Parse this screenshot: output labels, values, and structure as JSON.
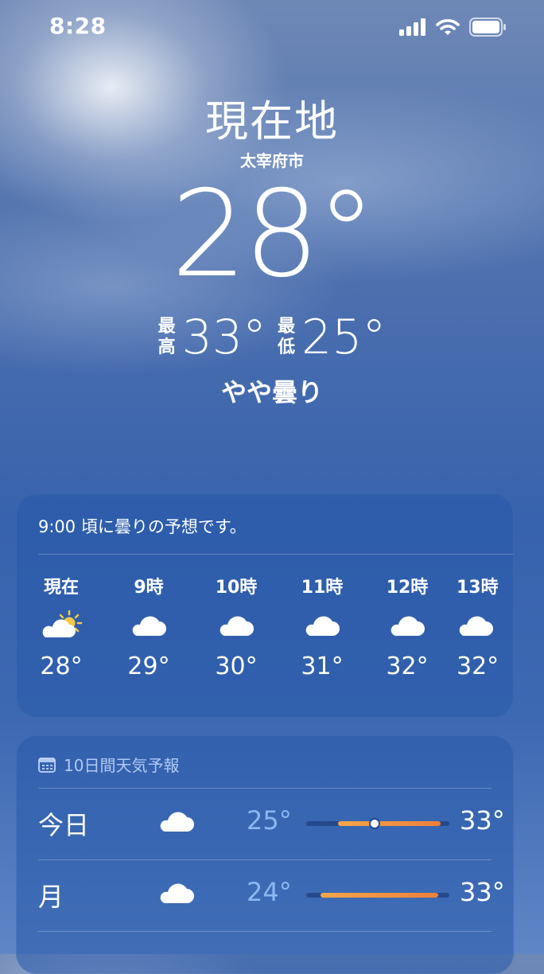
{
  "status_bar": {
    "time": "8:28"
  },
  "hero": {
    "location": "現在地",
    "city": "太宰府市",
    "temperature": "28°",
    "high_label_1": "最",
    "high_label_2": "高",
    "high": "33°",
    "low_label_1": "最",
    "low_label_2": "低",
    "low": "25°",
    "condition": "やや曇り"
  },
  "hourly": {
    "summary": "9:00 頃に曇りの予想です。",
    "items": [
      {
        "label": "現在",
        "icon": "partly-cloudy-icon",
        "temp": "28°"
      },
      {
        "label": "9時",
        "icon": "cloud-icon",
        "temp": "29°"
      },
      {
        "label": "10時",
        "icon": "cloud-icon",
        "temp": "30°"
      },
      {
        "label": "11時",
        "icon": "cloud-icon",
        "temp": "31°"
      },
      {
        "label": "12時",
        "icon": "cloud-icon",
        "temp": "32°"
      },
      {
        "label": "13時",
        "icon": "cloud-icon",
        "temp": "32°"
      }
    ]
  },
  "forecast": {
    "title": "10日間天気予報",
    "days": [
      {
        "day": "今日",
        "icon": "cloud-icon",
        "low": "25°",
        "high": "33°",
        "range_start_pct": 22,
        "range_end_pct": 94,
        "current_pct": 48
      },
      {
        "day": "月",
        "icon": "cloud-icon",
        "low": "24°",
        "high": "33°",
        "range_start_pct": 10,
        "range_end_pct": 92
      }
    ]
  },
  "colors": {
    "bar_start": "#f2a64a",
    "bar_end": "#ee7f3a",
    "low_temp": "#8db7f2"
  }
}
